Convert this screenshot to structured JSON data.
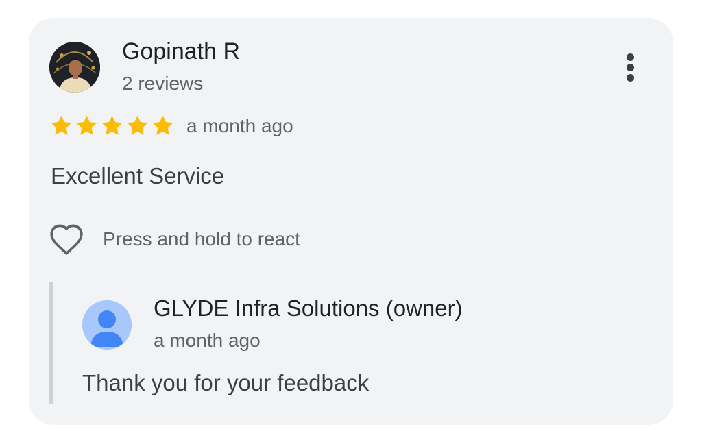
{
  "review": {
    "reviewer_name": "Gopinath R",
    "reviewer_reviews": "2 reviews",
    "rating": 5,
    "rating_max": 5,
    "time": "a month ago",
    "text": "Excellent Service",
    "react_label": "Press and hold to react",
    "star_color": "#fbbc04",
    "icons": {
      "more": "more-vertical-icon",
      "react": "heart-outline-icon"
    }
  },
  "owner_reply": {
    "name": "GLYDE Infra Solutions (owner)",
    "time": "a month ago",
    "text": "Thank you for your feedback",
    "avatar_icon": "person-icon",
    "avatar_color": "#a8c7fa",
    "avatar_figure_color": "#4285f4"
  }
}
